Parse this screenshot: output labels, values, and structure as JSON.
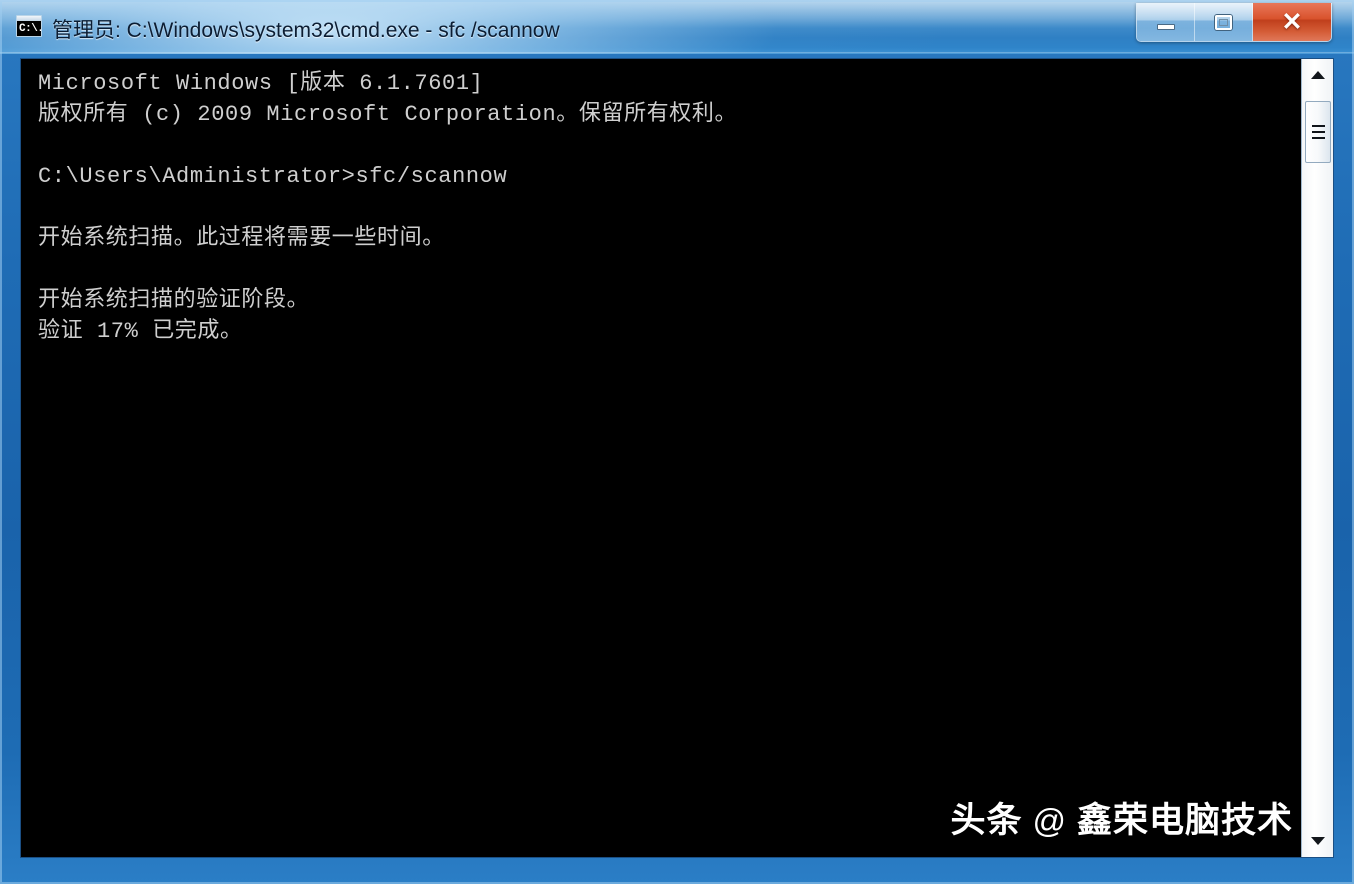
{
  "window": {
    "title": "管理员: C:\\Windows\\system32\\cmd.exe - sfc /scannow",
    "icon_label": "C:\\.",
    "icon_name": "cmd-console-icon",
    "accent_color": "#2f80c4",
    "close_color": "#d9522c",
    "console_bg": "#000000",
    "console_fg": "#cfcfcf"
  },
  "controls": {
    "minimize_label": "",
    "restore_label": "",
    "close_label": "✕",
    "minimize_name": "minimize",
    "restore_name": "restore",
    "close_name": "close"
  },
  "console": {
    "lines": [
      "Microsoft Windows [版本 6.1.7601]",
      "版权所有 (c) 2009 Microsoft Corporation。保留所有权利。",
      "",
      "C:\\Users\\Administrator>sfc/scannow",
      "",
      "开始系统扫描。此过程将需要一些时间。",
      "",
      "开始系统扫描的验证阶段。",
      "验证 17% 已完成。"
    ],
    "command": "sfc/scannow",
    "prompt": "C:\\Users\\Administrator>",
    "os_version": "6.1.7601",
    "copyright_year": "2009",
    "progress_percent": "17%",
    "progress_line": "验证 17% 已完成。"
  },
  "scrollbar": {
    "up_arrow": "▲",
    "down_arrow": "▼",
    "thumb_position": "top"
  },
  "watermark": {
    "platform": "头条",
    "at": "@",
    "account": "鑫荣电脑技术"
  }
}
